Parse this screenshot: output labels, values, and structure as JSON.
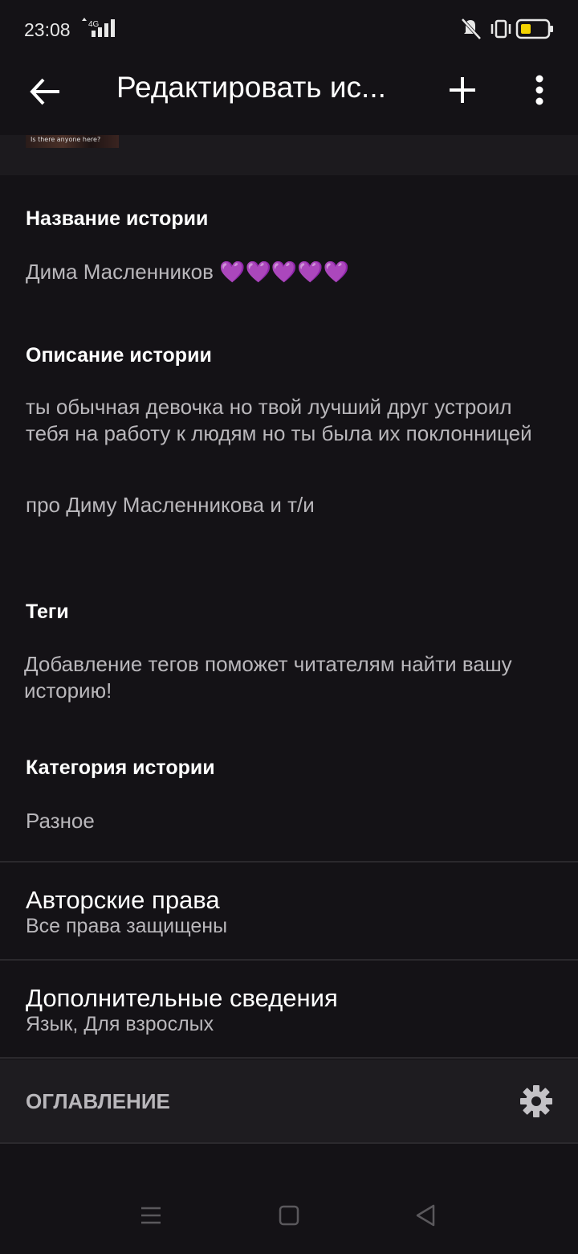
{
  "status_bar": {
    "time": "23:08",
    "network": "4G",
    "battery_color": "#f2d200",
    "icons": [
      "network-signal-icon",
      "mute-icon",
      "vibrate-icon",
      "battery-icon"
    ]
  },
  "toolbar": {
    "title": "Редактировать ис...",
    "back_icon": "arrow-left-icon",
    "add_icon": "plus-icon",
    "more_icon": "more-vertical-icon"
  },
  "cover": {
    "caption": "Is there anyone here?"
  },
  "story": {
    "title_label": "Название истории",
    "title_value": "Дима Масленников",
    "title_emoji": "💜💜💜💜💜",
    "description_label": "Описание истории",
    "description_p1": "ты обычная девочка но твой лучший друг устроил тебя на работу к людям но ты была их поклонницей",
    "description_p2": "про Диму Масленникова и т/и",
    "tags_label": "Теги",
    "tags_placeholder": "Добавление тегов поможет читателям найти вашу историю!",
    "category_label": "Категория истории",
    "category_value": "Разное"
  },
  "rows": {
    "copyright_title": "Авторские права",
    "copyright_value": "Все права защищены",
    "details_title": "Дополнительные сведения",
    "details_value": "Язык, Для взрослых"
  },
  "toc": {
    "label": "ОГЛАВЛЕНИЕ",
    "settings_icon": "gear-icon"
  },
  "nav": {
    "icons": [
      "menu-icon",
      "home-square-icon",
      "back-triangle-icon"
    ]
  },
  "colors": {
    "background": "#141216",
    "accent_heart": "#8a35c4",
    "text_primary": "#ffffff",
    "text_secondary": "#b9b7bb"
  }
}
